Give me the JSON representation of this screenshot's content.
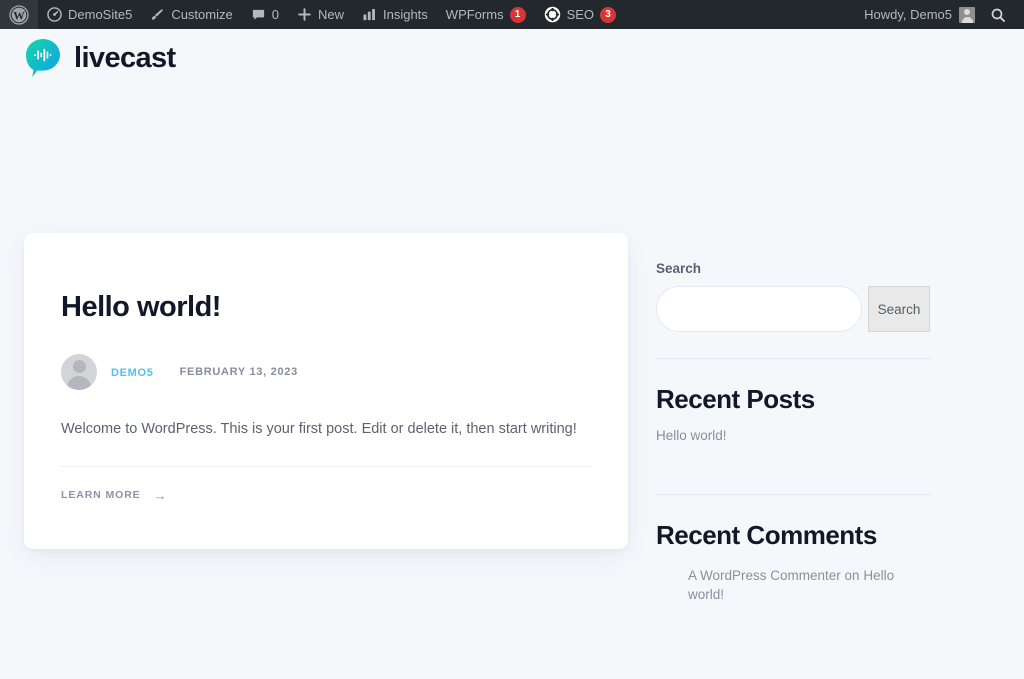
{
  "admin_bar": {
    "left_items": [
      {
        "id": "wp-logo",
        "icon": "wordpress-icon",
        "label": "",
        "badge": null
      },
      {
        "id": "site-name",
        "icon": "dashboard-icon",
        "label": "DemoSite5",
        "badge": null
      },
      {
        "id": "customize",
        "icon": "paintbrush-icon",
        "label": "Customize",
        "badge": null
      },
      {
        "id": "comments",
        "icon": "comment-icon",
        "label": "0",
        "badge": null
      },
      {
        "id": "new-content",
        "icon": "plus-icon",
        "label": "New",
        "badge": null
      },
      {
        "id": "insights",
        "icon": "bar-chart-icon",
        "label": "Insights",
        "badge": null
      },
      {
        "id": "wpforms",
        "icon": null,
        "label": "WPForms",
        "badge": "1"
      },
      {
        "id": "seo",
        "icon": "yoast-seo-icon",
        "label": "SEO",
        "badge": "3"
      }
    ],
    "howdy": "Howdy, Demo5",
    "search_icon": "search-icon"
  },
  "site": {
    "brand_name": "livecast",
    "brand_icon": "livecast-speech-bubble-waveform-icon"
  },
  "post": {
    "title": "Hello world!",
    "author": "DEMO5",
    "date": "FEBRUARY 13, 2023",
    "excerpt": "Welcome to WordPress. This is your first post. Edit or delete it, then start writing!",
    "read_more_label": "LEARN MORE",
    "read_more_arrow": "→"
  },
  "sidebar": {
    "search": {
      "label": "Search",
      "value": "",
      "placeholder": "",
      "button_label": "Search"
    },
    "recent_posts": {
      "title": "Recent Posts",
      "items": [
        "Hello world!"
      ]
    },
    "recent_comments": {
      "title": "Recent Comments",
      "items": [
        "A WordPress Commenter on Hello world!"
      ]
    }
  },
  "colors": {
    "admin_bar_bg": "#23282d",
    "page_bg": "#f5f8fb",
    "card_bg": "#ffffff",
    "accent_cyan": "#4fc3e8",
    "brand_gradient_from": "#18d4a8",
    "brand_gradient_to": "#1597e8",
    "badge_red": "#d63638",
    "heading": "#111828",
    "muted_text": "#8a8f9c"
  }
}
